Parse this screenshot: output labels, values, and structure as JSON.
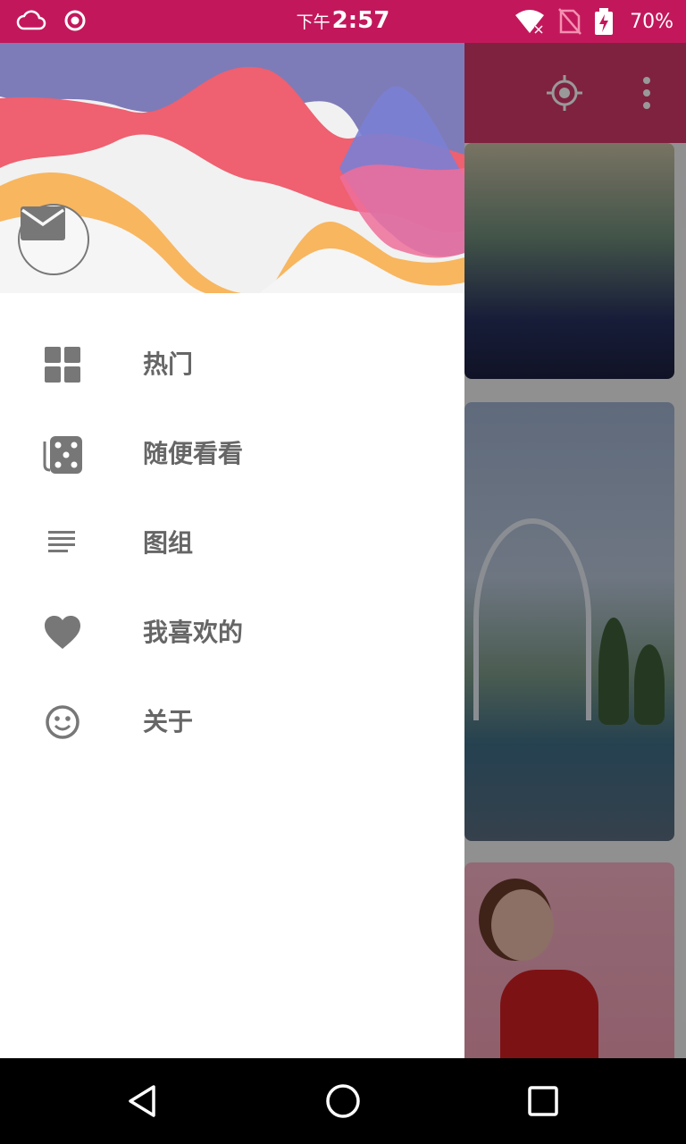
{
  "status_bar": {
    "time_prefix": "下午",
    "time": "2:57",
    "battery_percent": "70%",
    "icons": [
      "cloud-icon",
      "record-icon",
      "wifi-icon",
      "no-sim-icon",
      "battery-charging-icon"
    ],
    "background_color": "#c2185b"
  },
  "toolbar": {
    "icons": [
      "locate-icon",
      "more-vert-icon"
    ],
    "color": "#d23a6c"
  },
  "drawer": {
    "header_icon": "mail-icon",
    "items": [
      {
        "label": "热门",
        "icon": "grid-icon"
      },
      {
        "label": "随便看看",
        "icon": "dice-icon"
      },
      {
        "label": "图组",
        "icon": "list-icon"
      },
      {
        "label": "我喜欢的",
        "icon": "heart-icon"
      },
      {
        "label": "关于",
        "icon": "smiley-icon"
      }
    ]
  },
  "nav_bar": {
    "buttons": [
      "back-icon",
      "home-icon",
      "recents-icon"
    ]
  }
}
